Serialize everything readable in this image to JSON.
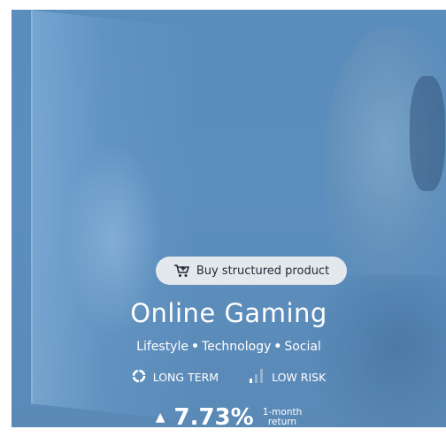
{
  "card": {
    "buy_button": {
      "label": "Buy structured product",
      "icon": "cart-icon"
    },
    "title": "Online Gaming",
    "tags": [
      "Lifestyle",
      "Technology",
      "Social"
    ],
    "tag_separator": "•",
    "term": {
      "label": "LONG TERM",
      "icon": "circle-progress-icon"
    },
    "risk": {
      "label": "LOW RISK",
      "icon": "signal-bars-icon",
      "level_bars": 1,
      "total_bars": 3
    },
    "return": {
      "arrow": "▲",
      "value": "7.73%",
      "label_line1": "1-month",
      "label_line2": "return"
    }
  },
  "colors": {
    "overlay": "#5a8cbc",
    "button_bg": "#e3e8ed",
    "text": "#ffffff"
  }
}
